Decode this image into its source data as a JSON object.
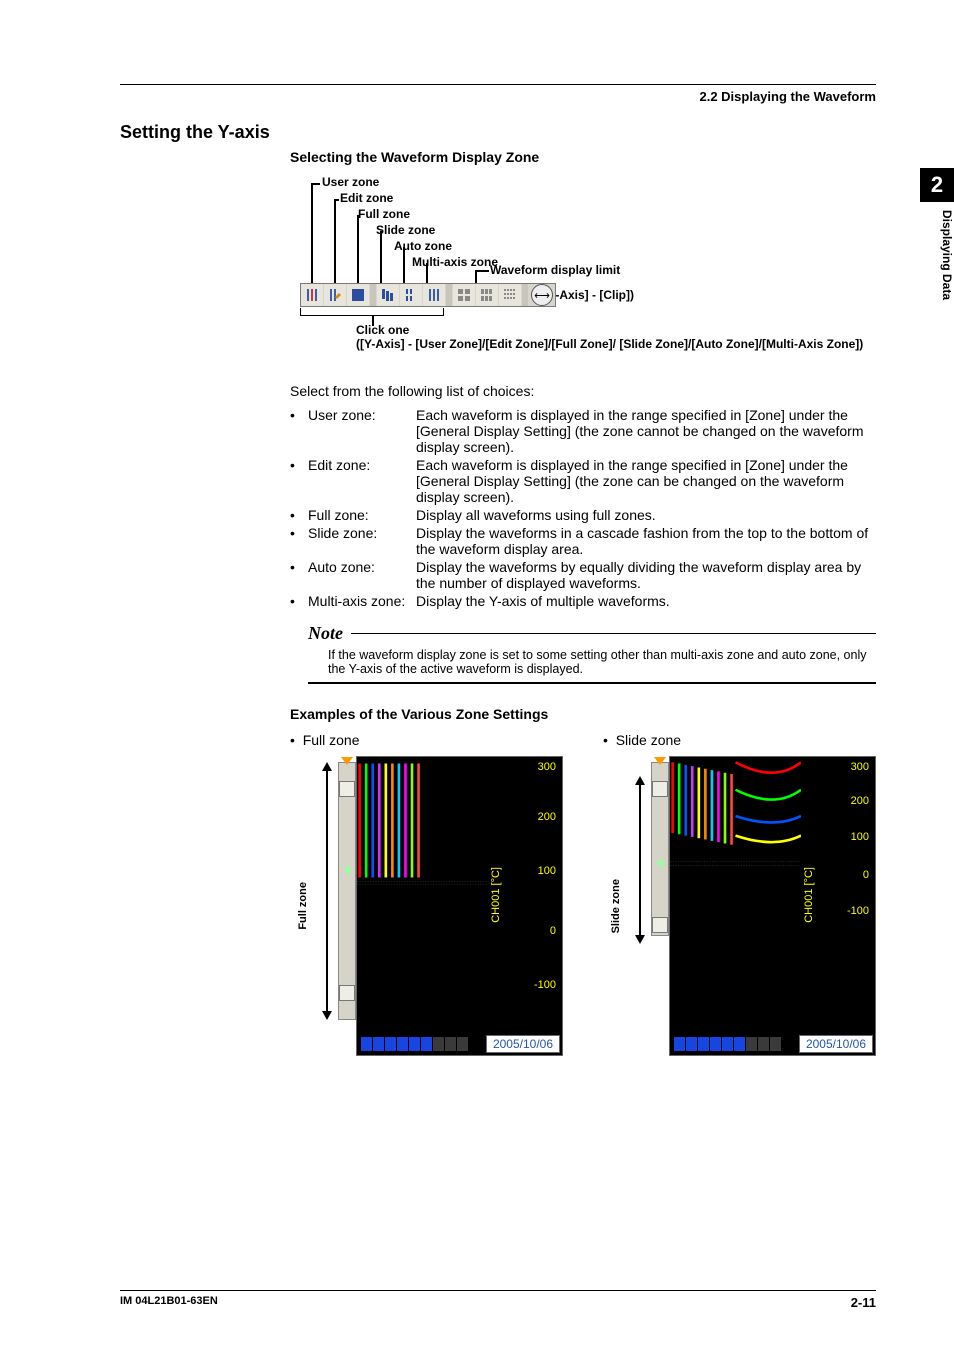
{
  "breadcrumb": "2.2  Displaying the Waveform",
  "sidebar": {
    "chapter_num": "2",
    "chapter_title": "Displaying Data"
  },
  "section_title": "Setting the Y-axis",
  "subsec1": "Selecting the Waveform Display Zone",
  "diagram": {
    "labels": {
      "user": "User zone",
      "edit": "Edit zone",
      "full": "Full zone",
      "slide": "Slide zone",
      "auto": "Auto zone",
      "multi": "Multi-axis zone",
      "limit": "Waveform display limit",
      "limit_menu": "([Y-Axis] - [Clip])",
      "click": "Click one",
      "click_menu": "([Y-Axis] - [User Zone]/[Edit Zone]/[Full Zone]/\n[Slide Zone]/[Auto Zone]/[Multi-Axis Zone])"
    }
  },
  "intro": "Select from the following list of choices:",
  "zones": [
    {
      "term": "User zone:",
      "desc": "Each waveform is displayed in the range specified in [Zone] under the [General Display Setting] (the zone cannot be changed on the waveform display screen)."
    },
    {
      "term": "Edit zone:",
      "desc": "Each waveform is displayed in the range specified in [Zone] under the [General Display Setting] (the zone can be changed on the waveform display screen)."
    },
    {
      "term": "Full zone:",
      "desc": "Display all waveforms using full zones."
    },
    {
      "term": "Slide zone:",
      "desc": "Display the waveforms in a cascade fashion from the top to the bottom of the waveform display area."
    },
    {
      "term": "Auto zone:",
      "desc": "Display the waveforms by equally dividing the waveform display area by the number of displayed waveforms."
    },
    {
      "term": "Multi-axis zone:",
      "desc": "Display the Y-axis of multiple waveforms."
    }
  ],
  "note": {
    "title": "Note",
    "body": "If the waveform display zone is set to some setting other than multi-axis zone and auto zone, only the Y-axis of the active waveform is displayed."
  },
  "subsec2": "Examples of the Various Zone Settings",
  "examples": {
    "full": {
      "label": "Full zone",
      "vlabel": "Full zone"
    },
    "slide": {
      "label": "Slide zone",
      "vlabel": "Slide zone"
    },
    "axis": {
      "channel": "CH001 [°C]",
      "ticks": [
        "300",
        "200",
        "100",
        "0",
        "-100"
      ],
      "date": "2005/10/06"
    }
  },
  "chart_data": {
    "type": "line",
    "note": "Two illustrative multi-channel waveform panels; values estimated from y-axis ticks.",
    "panels": [
      {
        "name": "Full zone",
        "yaxis_label": "CH001 [°C]",
        "ylim": [
          -100,
          300
        ],
        "date": "2005/10/06",
        "series_count": 10,
        "layout": "overlapping full-height"
      },
      {
        "name": "Slide zone",
        "yaxis_label": "CH001 [°C]",
        "ylim": [
          -100,
          300
        ],
        "date": "2005/10/06",
        "series_count": 10,
        "layout": "cascade top-to-bottom"
      }
    ]
  },
  "footer": {
    "left": "IM 04L21B01-63EN",
    "right": "2-11"
  }
}
